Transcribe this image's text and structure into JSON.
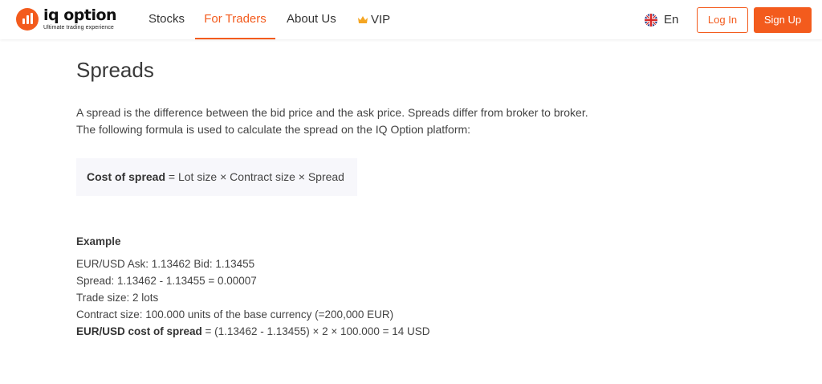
{
  "header": {
    "logo": {
      "name": "iq option",
      "tagline": "Ultimate trading experience"
    },
    "nav": [
      {
        "label": "Stocks"
      },
      {
        "label": "For Traders"
      },
      {
        "label": "About Us"
      },
      {
        "label": "VIP",
        "icon": "crown-icon"
      }
    ],
    "language": {
      "label": "En",
      "icon": "uk-flag-icon"
    },
    "login_label": "Log In",
    "signup_label": "Sign Up"
  },
  "content": {
    "title": "Spreads",
    "paragraph_lines": [
      "A spread is the difference between the bid price and the ask price. Spreads differ from broker to broker.",
      "The following formula is used to calculate the spread on the IQ Option platform:"
    ],
    "formula": {
      "bold": "Cost of spread",
      "rest": " = Lot size × Contract size × Spread"
    },
    "example_heading": "Example",
    "example_lines": [
      "EUR/USD Ask: 1.13462 Bid: 1.13455",
      "Spread: 1.13462 - 1.13455 = 0.00007",
      "Trade size: 2 lots",
      "Contract size: 100.000 units of the base currency (=200,000 EUR)"
    ],
    "example_total": {
      "bold": "EUR/USD cost of spread",
      "rest": " = (1.13462 - 1.13455) × 2 × 100.000 = 14 USD"
    }
  },
  "colors": {
    "accent": "#f35b1d",
    "text": "#444444",
    "formula_bg": "#f7f7fb"
  }
}
